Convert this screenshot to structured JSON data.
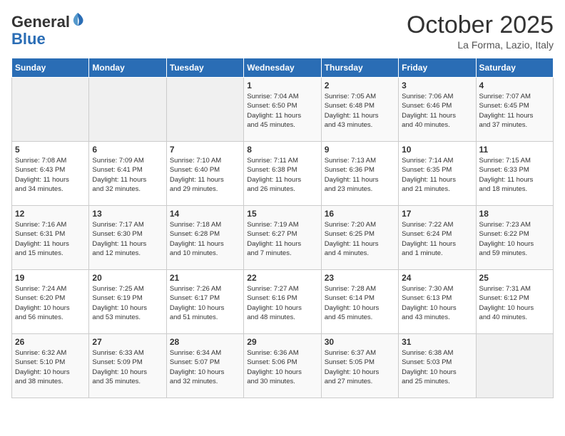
{
  "header": {
    "logo_line1": "General",
    "logo_line2": "Blue",
    "month_title": "October 2025",
    "location": "La Forma, Lazio, Italy"
  },
  "weekdays": [
    "Sunday",
    "Monday",
    "Tuesday",
    "Wednesday",
    "Thursday",
    "Friday",
    "Saturday"
  ],
  "weeks": [
    [
      {
        "day": "",
        "info": ""
      },
      {
        "day": "",
        "info": ""
      },
      {
        "day": "",
        "info": ""
      },
      {
        "day": "1",
        "info": "Sunrise: 7:04 AM\nSunset: 6:50 PM\nDaylight: 11 hours\nand 45 minutes."
      },
      {
        "day": "2",
        "info": "Sunrise: 7:05 AM\nSunset: 6:48 PM\nDaylight: 11 hours\nand 43 minutes."
      },
      {
        "day": "3",
        "info": "Sunrise: 7:06 AM\nSunset: 6:46 PM\nDaylight: 11 hours\nand 40 minutes."
      },
      {
        "day": "4",
        "info": "Sunrise: 7:07 AM\nSunset: 6:45 PM\nDaylight: 11 hours\nand 37 minutes."
      }
    ],
    [
      {
        "day": "5",
        "info": "Sunrise: 7:08 AM\nSunset: 6:43 PM\nDaylight: 11 hours\nand 34 minutes."
      },
      {
        "day": "6",
        "info": "Sunrise: 7:09 AM\nSunset: 6:41 PM\nDaylight: 11 hours\nand 32 minutes."
      },
      {
        "day": "7",
        "info": "Sunrise: 7:10 AM\nSunset: 6:40 PM\nDaylight: 11 hours\nand 29 minutes."
      },
      {
        "day": "8",
        "info": "Sunrise: 7:11 AM\nSunset: 6:38 PM\nDaylight: 11 hours\nand 26 minutes."
      },
      {
        "day": "9",
        "info": "Sunrise: 7:13 AM\nSunset: 6:36 PM\nDaylight: 11 hours\nand 23 minutes."
      },
      {
        "day": "10",
        "info": "Sunrise: 7:14 AM\nSunset: 6:35 PM\nDaylight: 11 hours\nand 21 minutes."
      },
      {
        "day": "11",
        "info": "Sunrise: 7:15 AM\nSunset: 6:33 PM\nDaylight: 11 hours\nand 18 minutes."
      }
    ],
    [
      {
        "day": "12",
        "info": "Sunrise: 7:16 AM\nSunset: 6:31 PM\nDaylight: 11 hours\nand 15 minutes."
      },
      {
        "day": "13",
        "info": "Sunrise: 7:17 AM\nSunset: 6:30 PM\nDaylight: 11 hours\nand 12 minutes."
      },
      {
        "day": "14",
        "info": "Sunrise: 7:18 AM\nSunset: 6:28 PM\nDaylight: 11 hours\nand 10 minutes."
      },
      {
        "day": "15",
        "info": "Sunrise: 7:19 AM\nSunset: 6:27 PM\nDaylight: 11 hours\nand 7 minutes."
      },
      {
        "day": "16",
        "info": "Sunrise: 7:20 AM\nSunset: 6:25 PM\nDaylight: 11 hours\nand 4 minutes."
      },
      {
        "day": "17",
        "info": "Sunrise: 7:22 AM\nSunset: 6:24 PM\nDaylight: 11 hours\nand 1 minute."
      },
      {
        "day": "18",
        "info": "Sunrise: 7:23 AM\nSunset: 6:22 PM\nDaylight: 10 hours\nand 59 minutes."
      }
    ],
    [
      {
        "day": "19",
        "info": "Sunrise: 7:24 AM\nSunset: 6:20 PM\nDaylight: 10 hours\nand 56 minutes."
      },
      {
        "day": "20",
        "info": "Sunrise: 7:25 AM\nSunset: 6:19 PM\nDaylight: 10 hours\nand 53 minutes."
      },
      {
        "day": "21",
        "info": "Sunrise: 7:26 AM\nSunset: 6:17 PM\nDaylight: 10 hours\nand 51 minutes."
      },
      {
        "day": "22",
        "info": "Sunrise: 7:27 AM\nSunset: 6:16 PM\nDaylight: 10 hours\nand 48 minutes."
      },
      {
        "day": "23",
        "info": "Sunrise: 7:28 AM\nSunset: 6:14 PM\nDaylight: 10 hours\nand 45 minutes."
      },
      {
        "day": "24",
        "info": "Sunrise: 7:30 AM\nSunset: 6:13 PM\nDaylight: 10 hours\nand 43 minutes."
      },
      {
        "day": "25",
        "info": "Sunrise: 7:31 AM\nSunset: 6:12 PM\nDaylight: 10 hours\nand 40 minutes."
      }
    ],
    [
      {
        "day": "26",
        "info": "Sunrise: 6:32 AM\nSunset: 5:10 PM\nDaylight: 10 hours\nand 38 minutes."
      },
      {
        "day": "27",
        "info": "Sunrise: 6:33 AM\nSunset: 5:09 PM\nDaylight: 10 hours\nand 35 minutes."
      },
      {
        "day": "28",
        "info": "Sunrise: 6:34 AM\nSunset: 5:07 PM\nDaylight: 10 hours\nand 32 minutes."
      },
      {
        "day": "29",
        "info": "Sunrise: 6:36 AM\nSunset: 5:06 PM\nDaylight: 10 hours\nand 30 minutes."
      },
      {
        "day": "30",
        "info": "Sunrise: 6:37 AM\nSunset: 5:05 PM\nDaylight: 10 hours\nand 27 minutes."
      },
      {
        "day": "31",
        "info": "Sunrise: 6:38 AM\nSunset: 5:03 PM\nDaylight: 10 hours\nand 25 minutes."
      },
      {
        "day": "",
        "info": ""
      }
    ]
  ]
}
